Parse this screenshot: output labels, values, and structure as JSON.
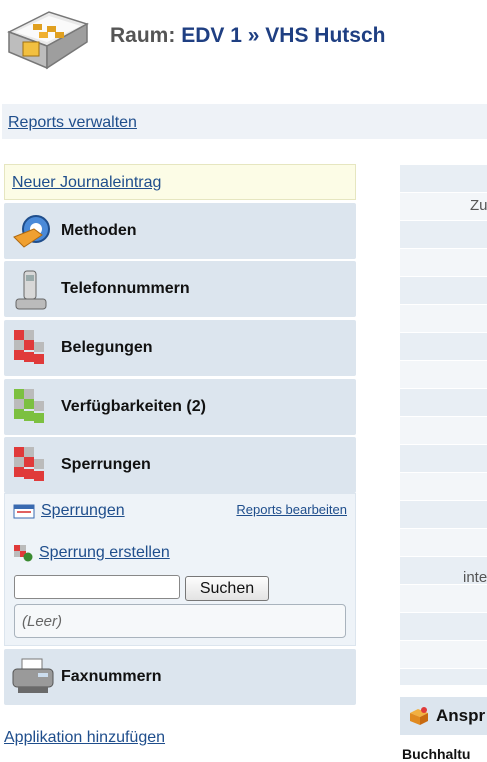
{
  "header": {
    "prefix": "Raum:",
    "room": "EDV 1",
    "separator": "»",
    "location": "VHS Hutsch"
  },
  "reports_bar": {
    "link": "Reports verwalten"
  },
  "journal": {
    "new_entry": "Neuer Journaleintrag"
  },
  "sections": {
    "methoden": {
      "label": "Methoden",
      "icon": "methods-icon"
    },
    "telefon": {
      "label": "Telefonnummern",
      "icon": "phone-icon"
    },
    "belegungen": {
      "label": "Belegungen",
      "icon": "bookings-icon"
    },
    "verfuegbarkeiten": {
      "label": "Verfügbarkeiten (2)",
      "icon": "availability-icon"
    },
    "sperrungen": {
      "label": "Sperrungen",
      "icon": "blocks-icon"
    },
    "fax": {
      "label": "Faxnummern",
      "icon": "fax-icon"
    }
  },
  "sperrungen_panel": {
    "list_link": "Sperrungen",
    "reports_edit": "Reports bearbeiten",
    "create_link": "Sperrung erstellen",
    "search_value": "",
    "search_button": "Suchen",
    "empty_text": "(Leer)"
  },
  "footer": {
    "add_application": "Applikation hinzufügen"
  },
  "right_panel": {
    "row_text_1": "Zu",
    "row_text_2": "inte",
    "section_title": "Anspr",
    "cutoff_text": "Buchhaltu"
  },
  "colors": {
    "link": "#1f4e8c",
    "section_bg": "#dce5ee",
    "title_accent": "#1f3f82"
  }
}
